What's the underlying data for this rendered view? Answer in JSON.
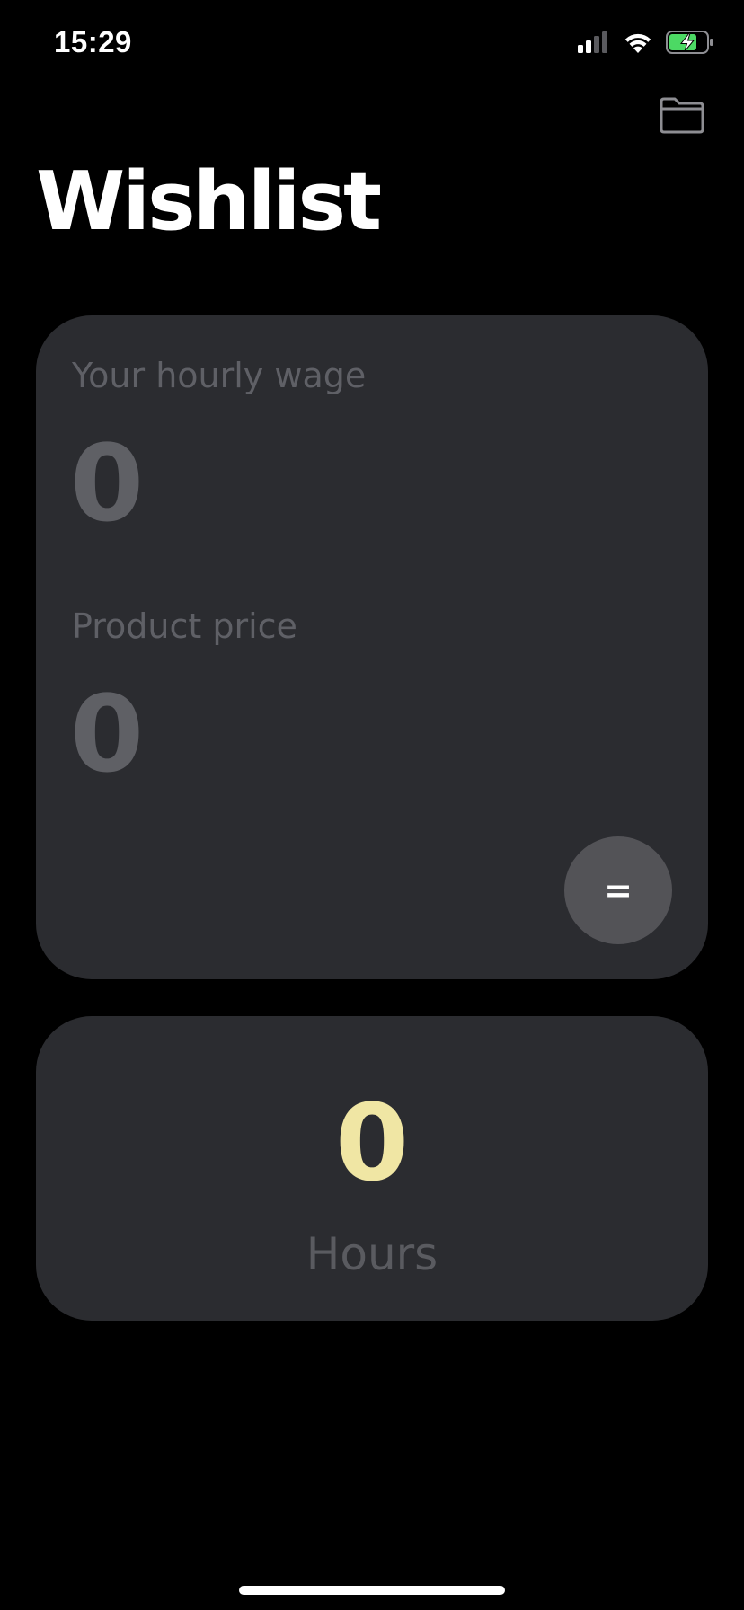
{
  "status_bar": {
    "time": "15:29",
    "icons": [
      "cellular-signal-icon",
      "wifi-icon",
      "battery-charging-icon"
    ],
    "battery_color": "#4cd964",
    "signal_bars_active": 2,
    "signal_bars_total": 4
  },
  "header": {
    "title": "Wishlist",
    "folder_icon": "folder-icon"
  },
  "input_card": {
    "wage_label": "Your hourly wage",
    "wage_value": "0",
    "price_label": "Product price",
    "price_value": "0",
    "equals_label": "="
  },
  "result_card": {
    "value": "0",
    "unit": "Hours"
  },
  "colors": {
    "background": "#000000",
    "card": "#2b2c30",
    "label": "#5f6066",
    "result_accent": "#f0e6a4",
    "equals_button": "#535357"
  }
}
